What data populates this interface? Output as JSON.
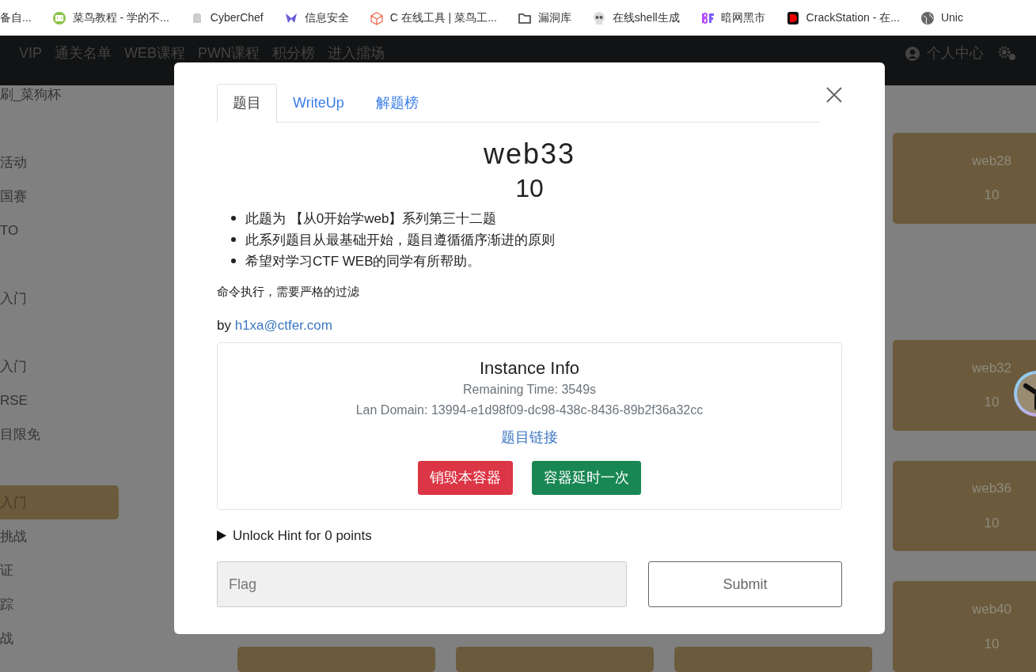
{
  "bookmarks": [
    {
      "label": "备自..."
    },
    {
      "label": "菜鸟教程 - 学的不..."
    },
    {
      "label": "CyberChef"
    },
    {
      "label": "信息安全"
    },
    {
      "label": "C 在线工具 | 菜鸟工..."
    },
    {
      "label": "漏洞库"
    },
    {
      "label": "在线shell生成"
    },
    {
      "label": "暗网黑市"
    },
    {
      "label": "CrackStation - 在..."
    },
    {
      "label": "Unic"
    }
  ],
  "navbar": {
    "items": [
      "VIP",
      "通关名单",
      "WEB课程",
      "PWN课程",
      "积分榜",
      "进入擂场"
    ],
    "user": "个人中心"
  },
  "sidebar": {
    "groups": [
      [
        {
          "label": "刷_菜狗杯",
          "selected": false
        }
      ],
      [
        {
          "label": "活动",
          "selected": false
        },
        {
          "label": "国赛",
          "selected": false
        },
        {
          "label": "TO",
          "selected": false
        }
      ],
      [
        {
          "label": "入门",
          "selected": false
        }
      ],
      [
        {
          "label": "入门",
          "selected": false
        },
        {
          "label": "RSE",
          "selected": false
        },
        {
          "label": "目限免",
          "selected": false
        }
      ],
      [
        {
          "label": "入门",
          "selected": true
        },
        {
          "label": "挑战",
          "selected": false
        },
        {
          "label": "证",
          "selected": false
        },
        {
          "label": "踪",
          "selected": false
        },
        {
          "label": "战",
          "selected": false
        }
      ]
    ]
  },
  "challenge_cards": [
    {
      "name": "web28",
      "points": "10"
    },
    {
      "name": "web32",
      "points": "10"
    },
    {
      "name": "web36",
      "points": "10"
    },
    {
      "name": "web40",
      "points": "10"
    }
  ],
  "modal": {
    "tabs": [
      {
        "label": "题目",
        "selected": true
      },
      {
        "label": "WriteUp",
        "selected": false
      },
      {
        "label": "解题榜",
        "selected": false
      }
    ],
    "title": "web33",
    "points": "10",
    "bullets": [
      "此题为 【从0开始学web】系列第三十二题",
      "此系列题目从最基础开始，题目遵循循序渐进的原则",
      "希望对学习CTF WEB的同学有所帮助。"
    ],
    "description": "命令执行，需要严格的过滤",
    "author_prefix": "by",
    "author_link": "h1xa@ctfer.com",
    "instance": {
      "title": "Instance Info",
      "remaining": "Remaining Time: 3549s",
      "domain": "Lan Domain: 13994-e1d98f09-dc98-438c-8436-89b2f36a32cc",
      "link": "题目链接",
      "buttons": [
        {
          "label": "销毁本容器",
          "kind": "danger"
        },
        {
          "label": "容器延时一次",
          "kind": "success"
        }
      ]
    },
    "hint": "Unlock Hint for 0 points",
    "flag": {
      "placeholder": "Flag"
    },
    "submit": "Submit"
  }
}
